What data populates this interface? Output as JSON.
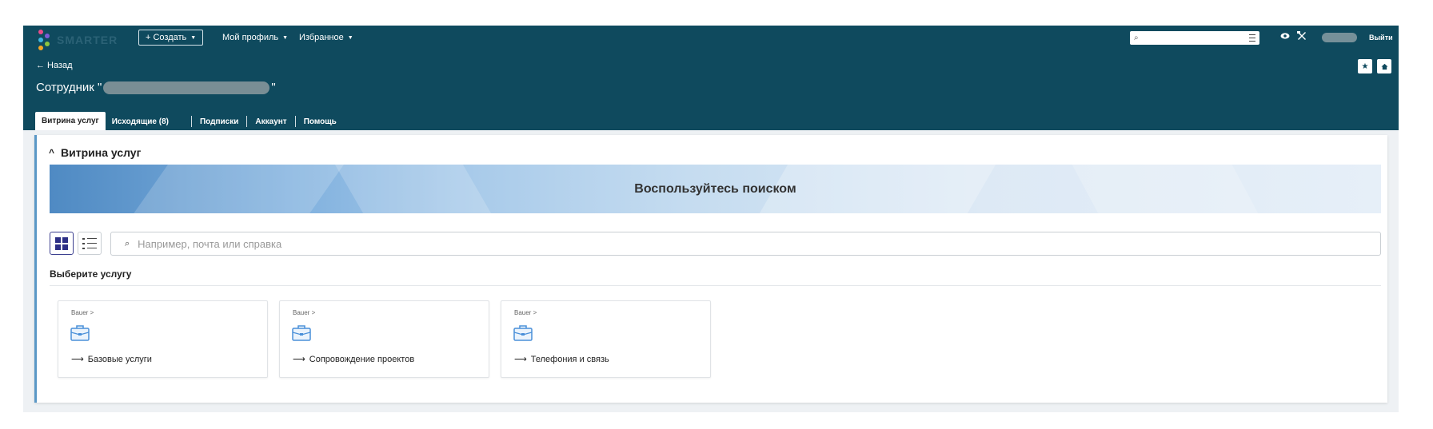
{
  "header": {
    "logo_text": "SMARTER",
    "create_label": "+ Создать",
    "profile_label": "Мой профиль",
    "favorites_label": "Избранное",
    "search_placeholder": "",
    "logout_label": "Выйти",
    "back_label": "← Назад",
    "title_prefix": "Сотрудник \"",
    "title_suffix": "\""
  },
  "tabs": [
    {
      "label": "Витрина услуг",
      "active": true
    },
    {
      "label": "Исходящие (8)",
      "active": false
    },
    {
      "label": "Подписки",
      "active": false
    },
    {
      "label": "Аккаунт",
      "active": false
    },
    {
      "label": "Помощь",
      "active": false
    }
  ],
  "showcase": {
    "section_title": "Витрина услуг",
    "banner_text": "Воспользуйтесь поиском",
    "search_placeholder": "Например, почта или справка",
    "choose_label": "Выберите услугу",
    "cards": [
      {
        "crumb": "Bauer >",
        "title": "Базовые услуги"
      },
      {
        "crumb": "Bauer >",
        "title": "Сопровождение проектов"
      },
      {
        "crumb": "Bauer >",
        "title": "Телефония и связь"
      }
    ]
  },
  "colors": {
    "header_bg": "#0f4a5e",
    "accent": "#5b98c6",
    "icon_blue": "#4a90d9"
  }
}
